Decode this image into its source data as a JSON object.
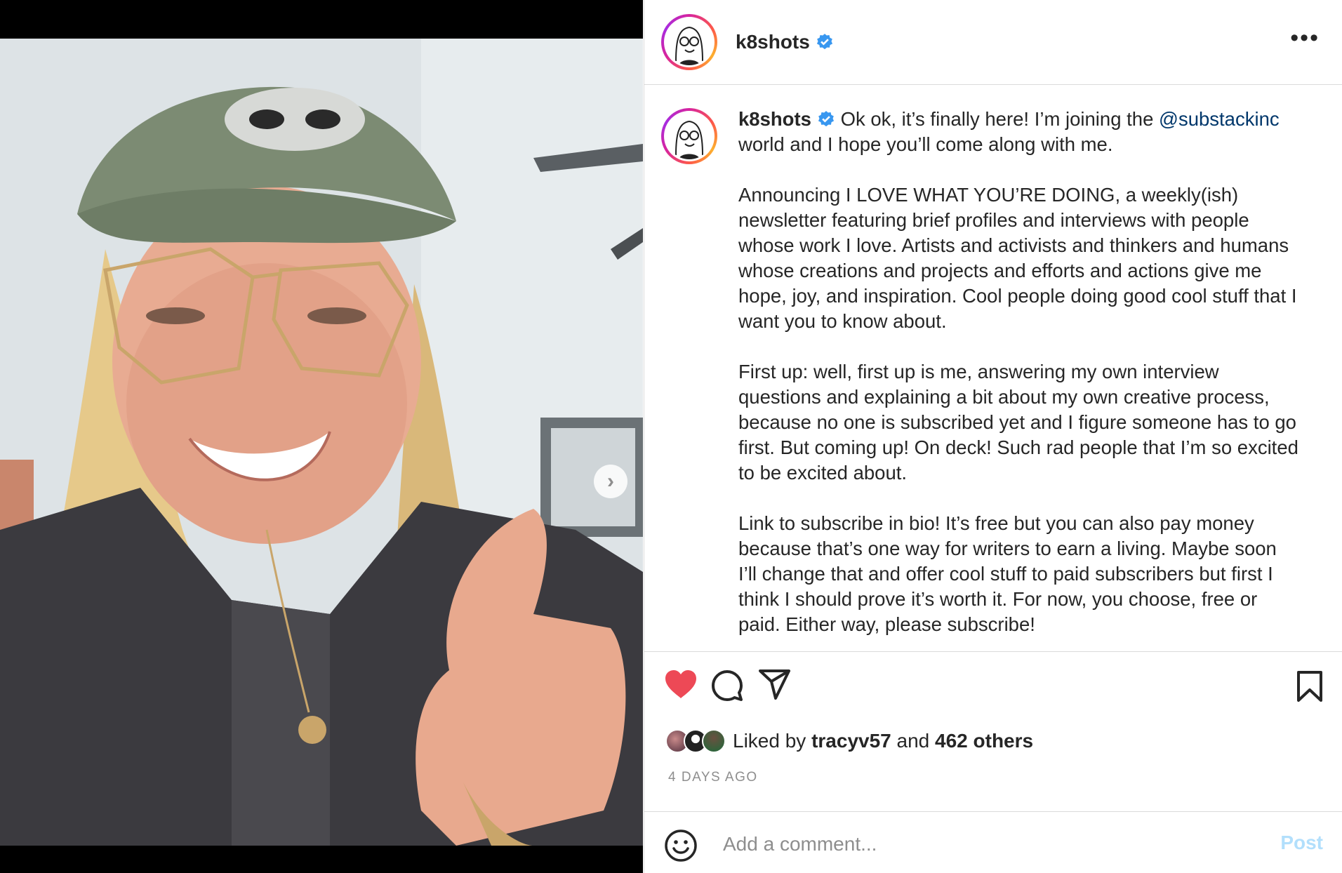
{
  "post": {
    "username": "k8shots",
    "verified": true,
    "carousel": {
      "slide_count": 5,
      "active_index": 0
    }
  },
  "header": {
    "username": "k8shots",
    "more_icon": "more-horizontal-icon"
  },
  "caption": {
    "username": "k8shots",
    "line1_pre": "Ok ok, it’s finally here! I’m joining the",
    "mention": "@substackinc",
    "line1_post": "world and I hope you’ll come along with me.",
    "para2": "Announcing I LOVE WHAT YOU’RE DOING, a weekly(ish) newsletter featuring brief profiles and interviews with people whose work I love. Artists and activists and thinkers and humans whose creations and projects and efforts and actions give me hope, joy, and inspiration. Cool people doing good cool stuff that I want you to know about.",
    "para3": "First up: well, first up is me, answering my own interview questions and explaining a bit about my own creative process, because no one is subscribed yet and I figure someone has to go first. But coming up! On deck! Such rad people that I’m so excited to be excited about.",
    "para4": "Link to subscribe in bio! It’s free but you can also pay money because that’s one way for writers to earn a living. Maybe soon I’ll change that and offer cool stuff to paid subscribers but first I think I should prove it’s worth it. For now, you choose, free or paid. Either way, please subscribe!"
  },
  "actions": {
    "liked": true,
    "like_color": "#ed4956",
    "icons": [
      "heart-icon",
      "comment-icon",
      "share-icon",
      "bookmark-icon"
    ]
  },
  "likes": {
    "prefix": "Liked by",
    "user": "tracyv57",
    "conj": "and",
    "others": "462 others"
  },
  "timestamp": "4 DAYS AGO",
  "comment": {
    "placeholder": "Add a comment...",
    "post_label": "Post"
  },
  "colors": {
    "mention": "#00376b",
    "verified": "#3897f0",
    "post_disabled": "#b2dffc"
  }
}
